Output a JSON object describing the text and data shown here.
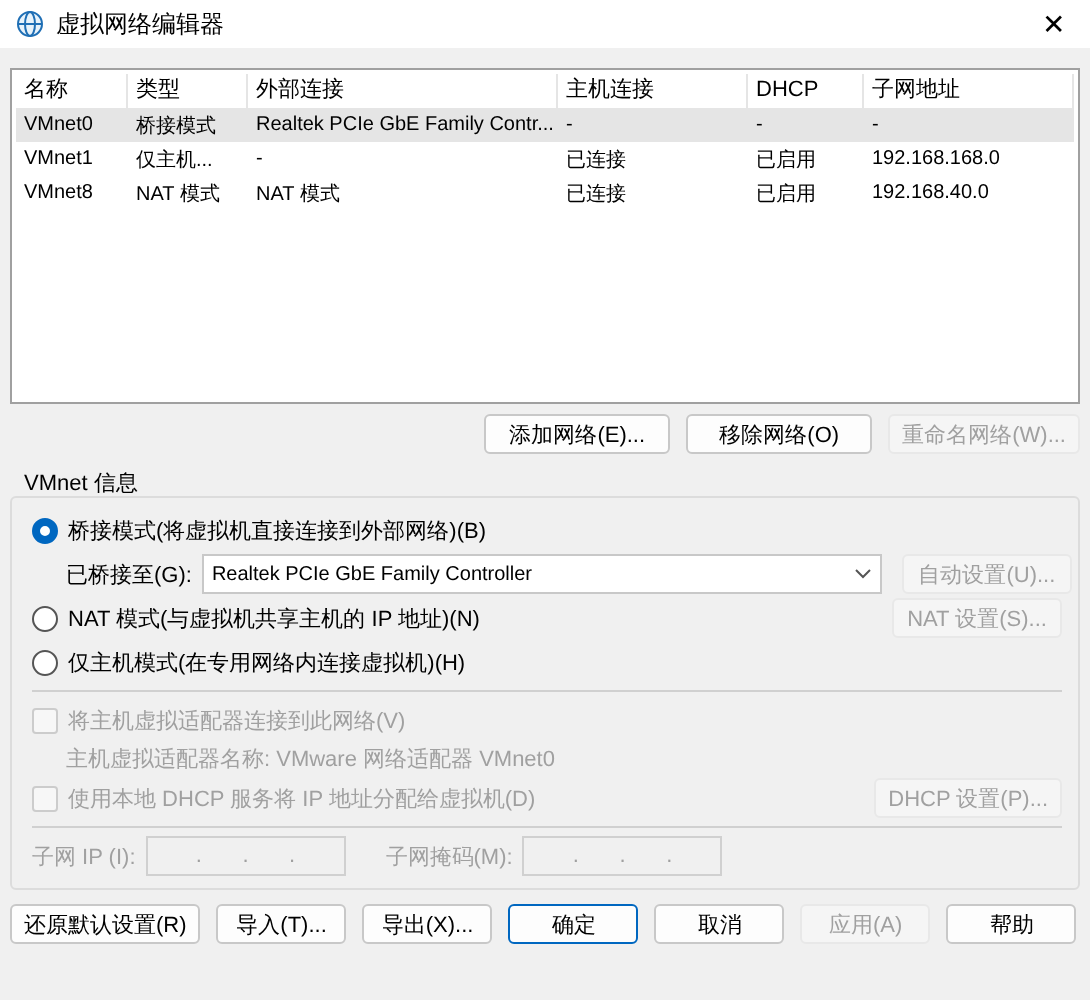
{
  "window": {
    "title": "虚拟网络编辑器",
    "close": "✕"
  },
  "table": {
    "columns": [
      "名称",
      "类型",
      "外部连接",
      "主机连接",
      "DHCP",
      "子网地址"
    ],
    "rows": [
      {
        "cells": [
          "VMnet0",
          "桥接模式",
          "Realtek PCIe GbE Family Contr...",
          "-",
          "-",
          "-"
        ],
        "selected": true
      },
      {
        "cells": [
          "VMnet1",
          "仅主机...",
          "-",
          "已连接",
          "已启用",
          "192.168.168.0"
        ],
        "selected": false
      },
      {
        "cells": [
          "VMnet8",
          "NAT 模式",
          "NAT 模式",
          "已连接",
          "已启用",
          "192.168.40.0"
        ],
        "selected": false
      }
    ]
  },
  "network_buttons": [
    {
      "label": "添加网络(E)...",
      "disabled": false
    },
    {
      "label": "移除网络(O)",
      "disabled": false
    },
    {
      "label": "重命名网络(W)...",
      "disabled": true
    }
  ],
  "info": {
    "title": "VMnet 信息",
    "modes": [
      {
        "label": "桥接模式(将虚拟机直接连接到外部网络)(B)",
        "selected": true
      },
      {
        "label": "NAT 模式(与虚拟机共享主机的 IP 地址)(N)",
        "selected": false,
        "button": {
          "label": "NAT 设置(S)...",
          "disabled": true
        }
      },
      {
        "label": "仅主机模式(在专用网络内连接虚拟机)(H)",
        "selected": false
      }
    ],
    "bridged_to": {
      "label": "已桥接至(G):",
      "value": "Realtek PCIe GbE Family Controller",
      "button": {
        "label": "自动设置(U)...",
        "disabled": true
      }
    },
    "connect_adapter": {
      "label": "将主机虚拟适配器连接到此网络(V)",
      "checked": false,
      "disabled": true
    },
    "adapter_name": "主机虚拟适配器名称: VMware 网络适配器 VMnet0",
    "use_dhcp": {
      "label": "使用本地 DHCP 服务将 IP 地址分配给虚拟机(D)",
      "checked": false,
      "disabled": true,
      "button": {
        "label": "DHCP 设置(P)...",
        "disabled": true
      }
    },
    "subnet_fields": [
      {
        "label": "子网 IP (I):",
        "dots": [
          ".",
          ".",
          "."
        ],
        "disabled": true
      },
      {
        "label": "子网掩码(M):",
        "dots": [
          ".",
          ".",
          "."
        ],
        "disabled": true
      }
    ]
  },
  "footer_buttons": [
    {
      "label": "还原默认设置(R)",
      "disabled": false,
      "default": false
    },
    {
      "label": "导入(T)...",
      "disabled": false,
      "default": false
    },
    {
      "label": "导出(X)...",
      "disabled": false,
      "default": false
    },
    {
      "label": "确定",
      "disabled": false,
      "default": true
    },
    {
      "label": "取消",
      "disabled": false,
      "default": false
    },
    {
      "label": "应用(A)",
      "disabled": true,
      "default": false
    },
    {
      "label": "帮助",
      "disabled": false,
      "default": false
    }
  ]
}
